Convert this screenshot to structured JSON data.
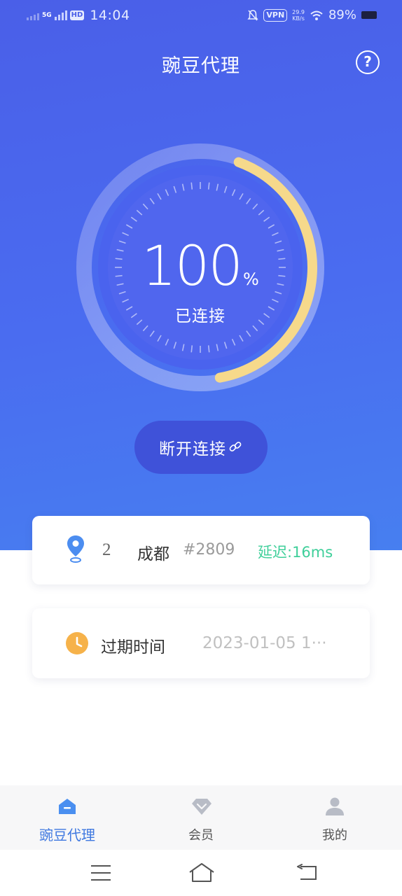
{
  "status_bar": {
    "network": "5G",
    "hd": "HD",
    "time": "14:04",
    "vpn": "VPN",
    "speed_value": "29.9",
    "speed_unit": "KB/s",
    "battery": "89%"
  },
  "header": {
    "title": "豌豆代理",
    "help_icon": "question-circle-icon"
  },
  "gauge": {
    "percent": "100",
    "unit": "%",
    "status": "已连接",
    "progress": 1.0,
    "ring_color": "#f6d98b"
  },
  "disconnect_button": {
    "label": "断开连接",
    "icon": "link-icon"
  },
  "server_card": {
    "number": "2",
    "city": "成都",
    "id": "#2809",
    "latency": "延迟:16ms",
    "icon": "location-pin-icon"
  },
  "expiry_card": {
    "label": "过期时间",
    "value": "2023-01-05 1···",
    "icon": "clock-icon"
  },
  "tabs": [
    {
      "label": "豌豆代理",
      "icon": "home-icon",
      "active": true
    },
    {
      "label": "会员",
      "icon": "diamond-icon",
      "active": false
    },
    {
      "label": "我的",
      "icon": "user-icon",
      "active": false
    }
  ],
  "colors": {
    "primary": "#4a63ee",
    "accent": "#3f78e0",
    "latency": "#3fcf9a"
  }
}
